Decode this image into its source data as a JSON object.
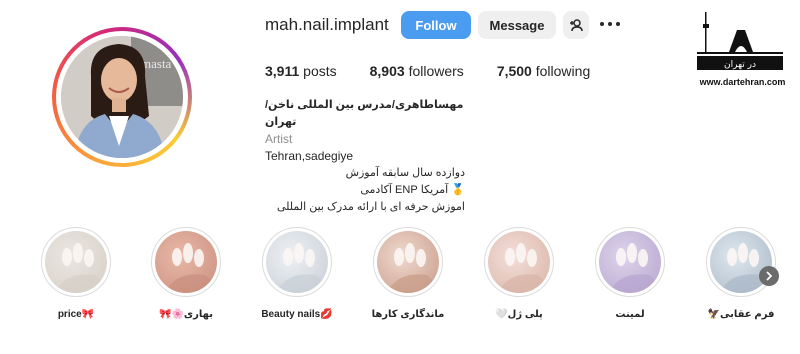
{
  "profile": {
    "username": "mah.nail.implant",
    "follow_label": "Follow",
    "message_label": "Message",
    "avatar_watermark": "masta"
  },
  "stats": {
    "posts_count": "3,911",
    "posts_label": "posts",
    "followers_count": "8,903",
    "followers_label": "followers",
    "following_count": "7,500",
    "following_label": "following"
  },
  "bio": {
    "name": "مهساطاهری/مدرس بین المللی ناخن/تهران",
    "category": "Artist",
    "lines": [
      "Tehran,sadegiye",
      "دوازده سال سابقه آموزش",
      "🥇 آمریکا ENP آکادمی",
      "اموزش حرفه ای با ارائه مدرک بین المللی"
    ]
  },
  "logo": {
    "title": "در تهران",
    "url": "www.dartehran.com"
  },
  "highlights": [
    {
      "label": "price🎀",
      "colors": [
        "#eae6e1",
        "#d6cfc6"
      ]
    },
    {
      "label": "بهاری🌸🎀",
      "colors": [
        "#e9b8a8",
        "#c98f7e"
      ]
    },
    {
      "label": "Beauty nails💋",
      "colors": [
        "#eef1f4",
        "#c7ced6"
      ]
    },
    {
      "label": "ماندگاری کارها",
      "colors": [
        "#f0d9cf",
        "#c79b88"
      ]
    },
    {
      "label": "پلی ژل🤍",
      "colors": [
        "#f3dfd9",
        "#d9b3a6"
      ]
    },
    {
      "label": "لمینت",
      "colors": [
        "#dcd4ea",
        "#b6a4cf"
      ]
    },
    {
      "label": "فرم عقابی🦅",
      "colors": [
        "#dfe7ee",
        "#a9b8c7"
      ]
    }
  ]
}
